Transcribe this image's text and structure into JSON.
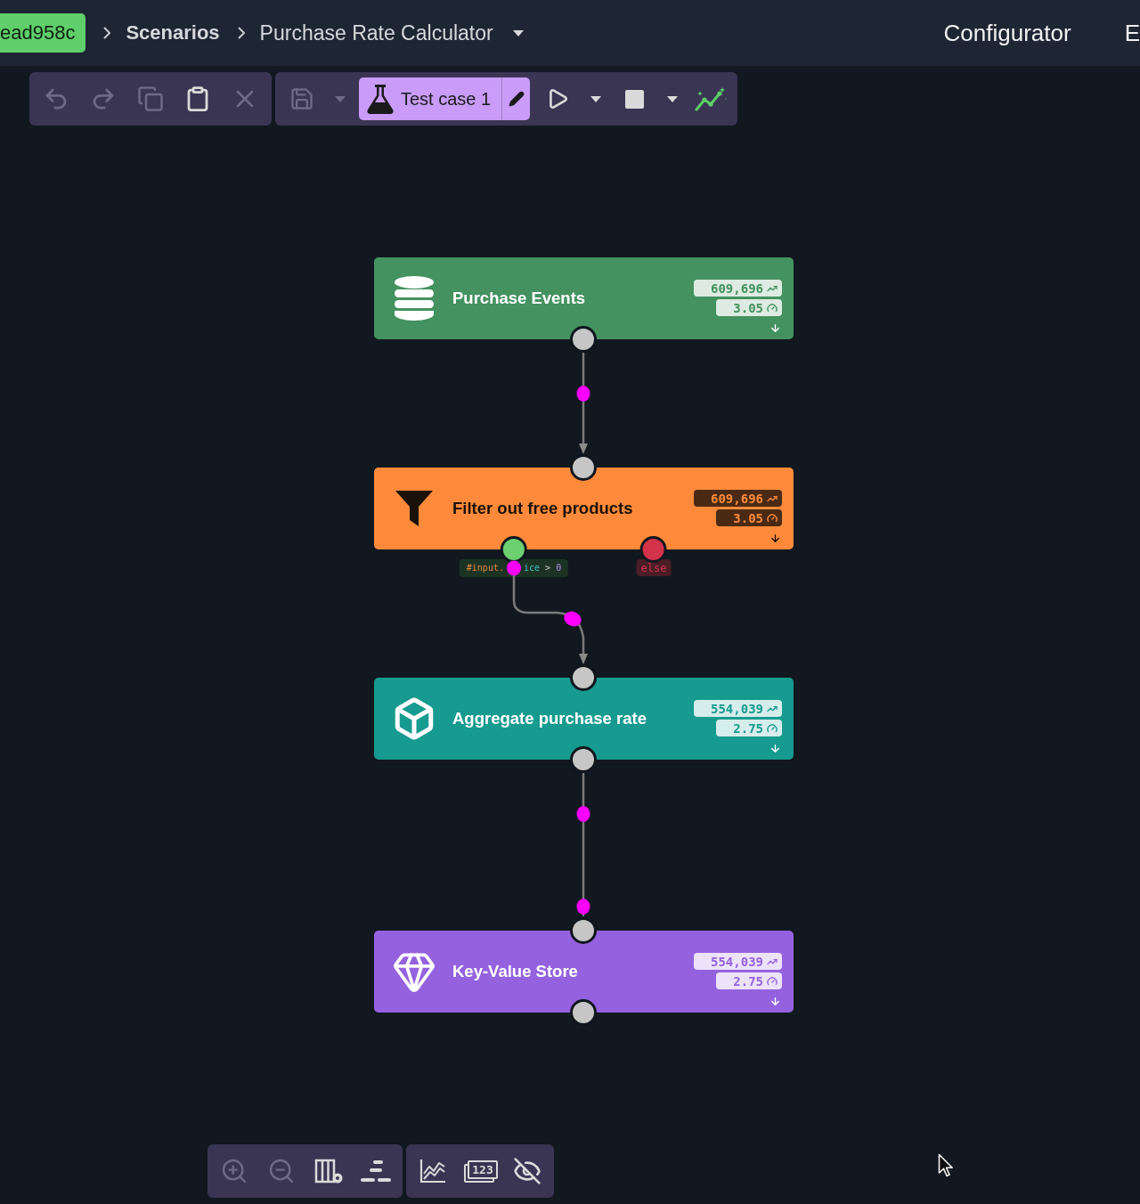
{
  "header": {
    "commit": "ead958c",
    "breadcrumbs": [
      {
        "label": "Scenarios",
        "current": false
      },
      {
        "label": "Purchase Rate Calculator",
        "current": true
      }
    ],
    "nav": [
      "Configurator",
      "E"
    ]
  },
  "toolbar": [
    {
      "items": [
        {
          "kind": "undo",
          "disabled": true
        },
        {
          "kind": "redo",
          "disabled": true
        },
        {
          "kind": "copy",
          "disabled": true
        },
        {
          "kind": "paste",
          "disabled": false
        },
        {
          "kind": "delete",
          "disabled": true
        }
      ]
    },
    {
      "items": [
        {
          "kind": "save",
          "disabled": true
        },
        {
          "kind": "dropdown",
          "disabled": true
        },
        {
          "kind": "test_case",
          "label": "Test case 1",
          "disabled": false
        },
        {
          "kind": "run",
          "disabled": false
        },
        {
          "kind": "dropdown",
          "disabled": false
        },
        {
          "kind": "stop",
          "disabled": false
        },
        {
          "kind": "dropdown",
          "disabled": false
        },
        {
          "kind": "metrics",
          "disabled": false
        }
      ]
    }
  ],
  "nodes": [
    {
      "title": "Purchase Events",
      "kind": "source",
      "color": "#44925f",
      "dark_text": false,
      "count": "609,696",
      "rate": "3.05"
    },
    {
      "title": "Filter out free products",
      "kind": "filter",
      "color": "#fd8a3b",
      "dark_text": true,
      "count": "609,696",
      "rate": "3.05",
      "branches": [
        {
          "kind": "condition",
          "color": "#6cd070",
          "tokens": [
            {
              "text": "#input.",
              "kind": "variable"
            },
            {
              "text": "ice",
              "kind": "property"
            },
            {
              "text": ">",
              "kind": "operator"
            },
            {
              "text": "0",
              "kind": "number"
            }
          ]
        },
        {
          "kind": "else",
          "color": "#d3334b",
          "label": "else"
        }
      ]
    },
    {
      "title": "Aggregate purchase rate",
      "kind": "aggregate",
      "color": "#179a8f",
      "dark_text": false,
      "count": "554,039",
      "rate": "2.75"
    },
    {
      "title": "Key-Value Store",
      "kind": "sink",
      "color": "#9462df",
      "dark_text": false,
      "count": "554,039",
      "rate": "2.75"
    }
  ],
  "view_controls": [
    {
      "items": [
        {
          "kind": "zoom_in",
          "disabled": true
        },
        {
          "kind": "zoom_out",
          "disabled": true
        },
        {
          "kind": "columns",
          "disabled": false
        },
        {
          "kind": "layout",
          "disabled": false
        }
      ]
    },
    {
      "items": [
        {
          "kind": "chart",
          "disabled": false
        },
        {
          "kind": "counts",
          "label": "123",
          "disabled": false
        },
        {
          "kind": "visibility",
          "disabled": false
        }
      ]
    }
  ]
}
